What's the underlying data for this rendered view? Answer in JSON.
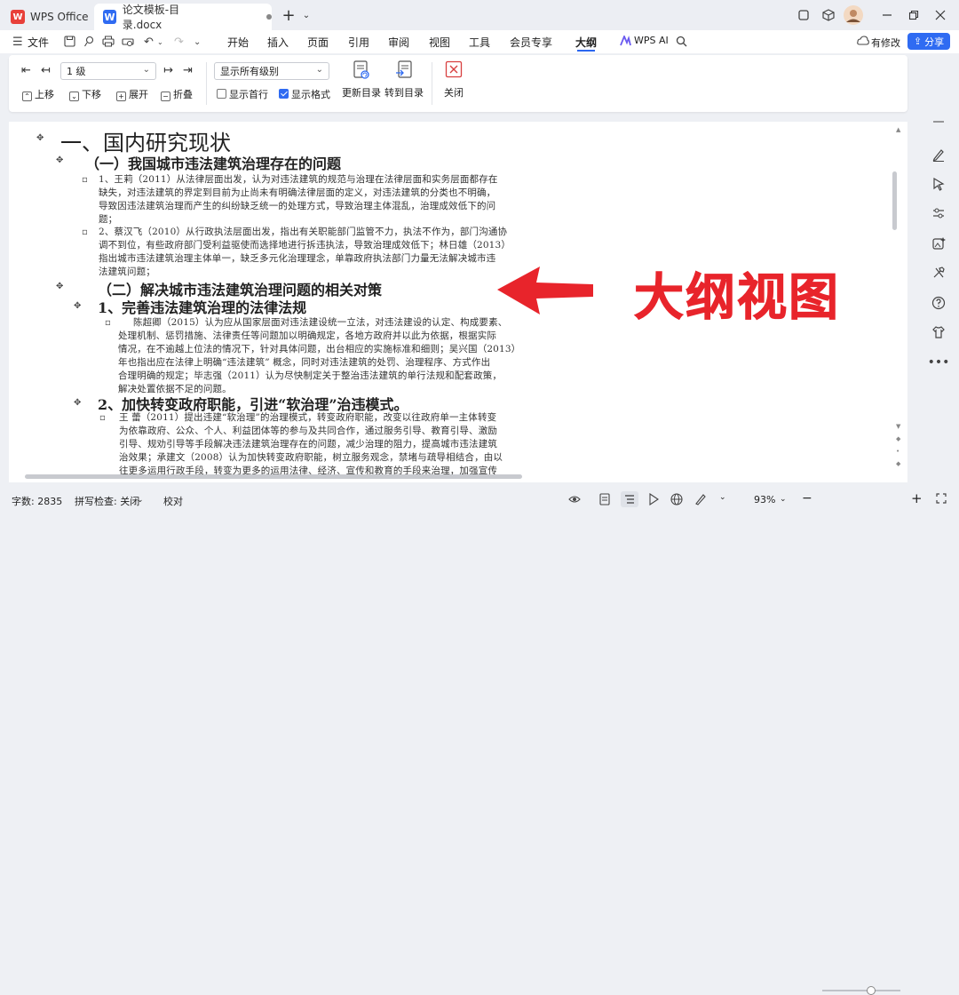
{
  "titlebar": {
    "app_tab": "WPS Office",
    "app_logo": "W",
    "doc_tab": "论文模板-目录.docx",
    "doc_logo": "W",
    "new_tab": "+",
    "tab_list": "⌄"
  },
  "menu": {
    "file": "文件",
    "tabs": [
      "开始",
      "插入",
      "页面",
      "引用",
      "审阅",
      "视图",
      "工具",
      "会员专享",
      "大纲",
      "WPS AI"
    ],
    "edit_mode": "有修改",
    "share": "分享"
  },
  "ribbon": {
    "level_value": "1 级",
    "up": "上移",
    "down": "下移",
    "expand": "展开",
    "collapse": "折叠",
    "show_levels_value": "显示所有级别",
    "show_first_line": "显示首行",
    "show_format": "显示格式",
    "show_format_checked": true,
    "show_first_line_checked": false,
    "update_toc": "更新目录",
    "goto_toc": "转到目录",
    "close": "关闭"
  },
  "document": {
    "h1": "一、国内研究现状",
    "h2a": "（一）我国城市违法建筑治理存在的问题",
    "p1": [
      "1、王莉（2011）从法律层面出发，认为对违法建筑的规范与治理在法律层面和实务层面都存在",
      "缺失，对违法建筑的界定到目前为止尚未有明确法律层面的定义，对违法建筑的分类也不明确，",
      "导致因违法建筑治理而产生的纠纷缺乏统一的处理方式，导致治理主体混乱，治理成效低下的问",
      "题；"
    ],
    "p2": [
      "2、蔡汉飞（2010）从行政执法层面出发，指出有关职能部门监管不力，执法不作为，部门沟通协",
      "调不到位，有些政府部门受利益驱使而选择地进行拆违执法，导致治理成效低下；林日雄（2013）",
      "指出城市违法建筑治理主体单一，缺乏多元化治理理念，单靠政府执法部门力量无法解决城市违",
      "法建筑问题；"
    ],
    "h2b": "（二）解决城市违法建筑治理问题的相关对策",
    "h3a": "1、完善违法建筑治理的法律法规",
    "p3": [
      "陈超卿（2015）认为应从国家层面对违法建设统一立法，对违法建设的认定、构成要素、",
      "处理机制、惩罚措施、法律责任等问题加以明确规定，各地方政府并以此为依据，根据实际",
      "情况，在不逾越上位法的情况下，针对具体问题，出台相应的实施标准和细则；吴兴国（2013）",
      "年也指出应在法律上明确“违法建筑” 概念，同时对违法建筑的处罚、治理程序、方式作出",
      "合理明确的规定；毕志强（2011）认为尽快制定关于整治违法建筑的单行法规和配套政策，",
      "解决处置依据不足的问题。"
    ],
    "h3b": "2、加快转变政府职能，引进“软治理”治违模式。",
    "p4": [
      "王 蕾（2011）提出违建“软治理”的治理模式，转变政府职能，改变以往政府单一主体转变",
      "为依靠政府、公众、个人、利益团体等的参与及共同合作，通过服务引导、教育引导、激励",
      "引导、规劝引导等手段解决违法建筑治理存在的问题，减少治理的阻力，提高城市违法建筑",
      "治效果；承建文（2008）认为加快转变政府职能，树立服务观念，禁堵与疏导相结合，由以",
      "往更多运用行政手段，转变为更多的运用法律、经济、宣传和教育的手段来治理，加强宣传"
    ]
  },
  "overlay": {
    "label": "大纲视图",
    "arrow_color": "#e8242b"
  },
  "status": {
    "word_count": "字数: 2835",
    "spell_check": "拼写检查: 关闭",
    "proofread": "校对",
    "zoom": "93%",
    "zoom_level": 0.62
  },
  "colors": {
    "accent": "#2f6bf2",
    "wps_red": "#e8403a"
  }
}
